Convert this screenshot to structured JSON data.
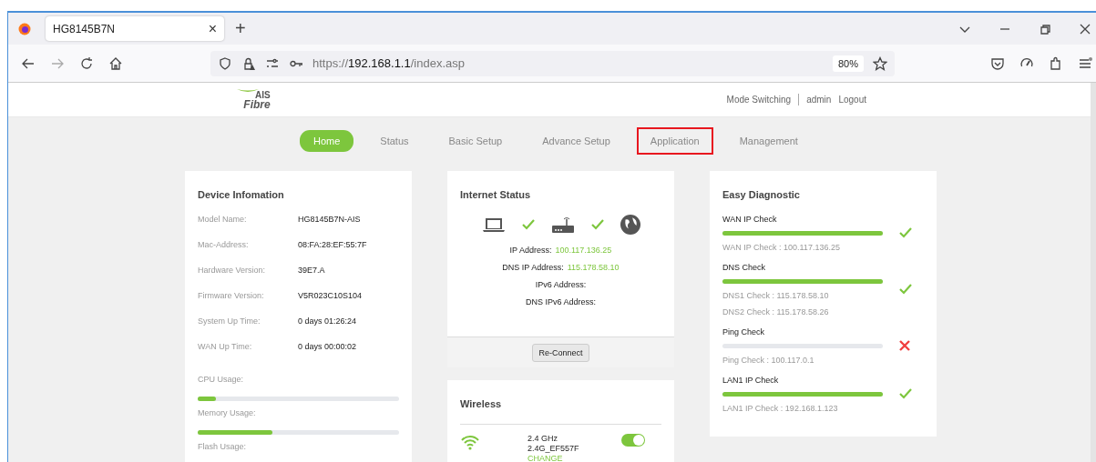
{
  "browser": {
    "tab": {
      "title": "HG8145B7N",
      "close": "×"
    },
    "new_tab": "+",
    "url": {
      "scheme": "https://",
      "host": "192.168.1.1",
      "path": "/index.asp"
    },
    "zoom": "80%"
  },
  "header": {
    "logo": {
      "top": "AIS",
      "bottom": "Fibre"
    },
    "links": [
      "Mode Switching",
      "admin",
      "Logout"
    ]
  },
  "nav": [
    {
      "label": "Home",
      "selected": true,
      "highlighted": false
    },
    {
      "label": "Status",
      "selected": false,
      "highlighted": false
    },
    {
      "label": "Basic Setup",
      "selected": false,
      "highlighted": false
    },
    {
      "label": "Advance Setup",
      "selected": false,
      "highlighted": false
    },
    {
      "label": "Application",
      "selected": false,
      "highlighted": true
    },
    {
      "label": "Management",
      "selected": false,
      "highlighted": false
    }
  ],
  "device": {
    "title": "Device Infomation",
    "rows": [
      {
        "label": "Model Name:",
        "value": "HG8145B7N-AIS"
      },
      {
        "label": "Mac-Address:",
        "value": "08:FA:28:EF:55:7F"
      },
      {
        "label": "Hardware Version:",
        "value": "39E7.A"
      },
      {
        "label": "Firmware Version:",
        "value": "V5R023C10S104"
      },
      {
        "label": "System Up Time:",
        "value": "0 days 01:26:24"
      },
      {
        "label": "WAN Up Time:",
        "value": "0 days 00:00:02"
      }
    ],
    "usage": [
      {
        "label": "CPU Usage:",
        "level": 0.09
      },
      {
        "label": "Memory Usage:",
        "level": 0.37
      },
      {
        "label": "Flash Usage:"
      }
    ]
  },
  "internet": {
    "title": "Internet Status",
    "fields": [
      {
        "label": "IP Address:",
        "value": "100.117.136.25"
      },
      {
        "label": "DNS IP Address:",
        "value": "115.178.58.10"
      },
      {
        "label": "IPv6 Address:"
      },
      {
        "label": "DNS IPv6 Address:"
      }
    ],
    "button": "Re-Connect"
  },
  "wireless": {
    "title": "Wireless",
    "bands": [
      {
        "band": "2.4 GHz",
        "ssid": "2.4G_EF557F",
        "action": "CHANGE",
        "on": true
      }
    ]
  },
  "diagnostic": {
    "title": "Easy Diagnostic",
    "checks": [
      {
        "name": "WAN IP Check",
        "level": 1,
        "passed": true,
        "details": [
          "WAN IP Check : 100.117.136.25"
        ]
      },
      {
        "name": "DNS Check",
        "level": 1,
        "passed": true,
        "details": [
          "DNS1 Check : 115.178.58.10",
          "DNS2 Check : 115.178.58.26"
        ]
      },
      {
        "name": "Ping Check",
        "level": 0,
        "passed": false,
        "details": [
          "Ping Check : 100.117.0.1"
        ]
      },
      {
        "name": "LAN1 IP Check",
        "level": 1,
        "passed": true,
        "details": [
          "LAN1 IP Check : 192.168.1.123"
        ]
      }
    ]
  }
}
